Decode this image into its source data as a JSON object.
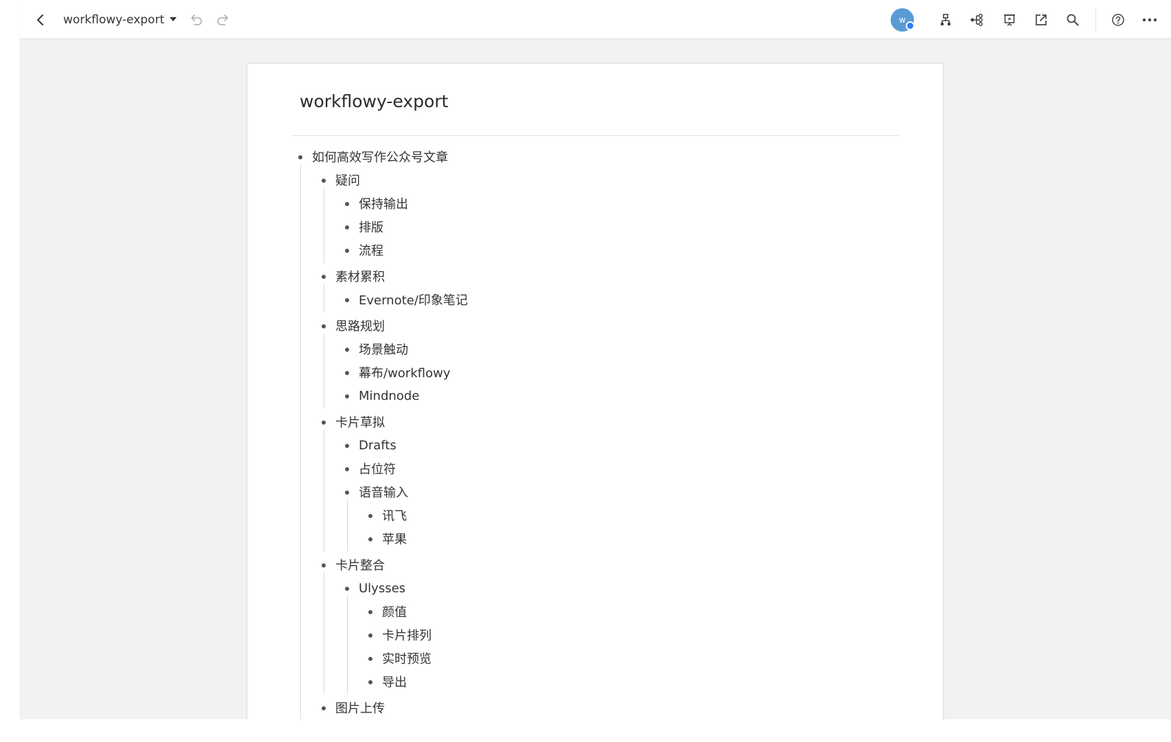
{
  "toolbar": {
    "document_name": "workflowy-export",
    "avatar_initial": "w",
    "icons": [
      "back-icon",
      "undo-icon",
      "redo-icon",
      "structure-icon",
      "mindmap-icon",
      "presentation-icon",
      "share-export-icon",
      "search-icon",
      "help-icon",
      "more-icon"
    ]
  },
  "document": {
    "title": "workflowy-export",
    "outline": [
      {
        "level": 0,
        "text": "如何高效写作公众号文章"
      },
      {
        "level": 1,
        "text": "疑问"
      },
      {
        "level": 2,
        "text": "保持输出"
      },
      {
        "level": 2,
        "text": "排版"
      },
      {
        "level": 2,
        "text": "流程"
      },
      {
        "level": 1,
        "text": "素材累积"
      },
      {
        "level": 2,
        "text": "Evernote/印象笔记"
      },
      {
        "level": 1,
        "text": "思路规划"
      },
      {
        "level": 2,
        "text": "场景触动"
      },
      {
        "level": 2,
        "text": "幕布/workflowy"
      },
      {
        "level": 2,
        "text": "Mindnode"
      },
      {
        "level": 1,
        "text": "卡片草拟"
      },
      {
        "level": 2,
        "text": "Drafts"
      },
      {
        "level": 2,
        "text": "占位符"
      },
      {
        "level": 2,
        "text": "语音输入"
      },
      {
        "level": 3,
        "text": "讯飞"
      },
      {
        "level": 3,
        "text": "苹果"
      },
      {
        "level": 1,
        "text": "卡片整合"
      },
      {
        "level": 2,
        "text": "Ulysses"
      },
      {
        "level": 3,
        "text": "颜值"
      },
      {
        "level": 3,
        "text": "卡片排列"
      },
      {
        "level": 3,
        "text": "实时预览"
      },
      {
        "level": 3,
        "text": "导出"
      },
      {
        "level": 1,
        "text": "图片上传"
      }
    ]
  },
  "colors": {
    "workspace_bg": "#f2f2f2",
    "paper_bg": "#ffffff",
    "avatar": "#5b9bd5",
    "presence_dot": "#2f7bf6",
    "text": "#333333",
    "icon": "#444444",
    "icon_disabled": "#b5b5b5"
  }
}
